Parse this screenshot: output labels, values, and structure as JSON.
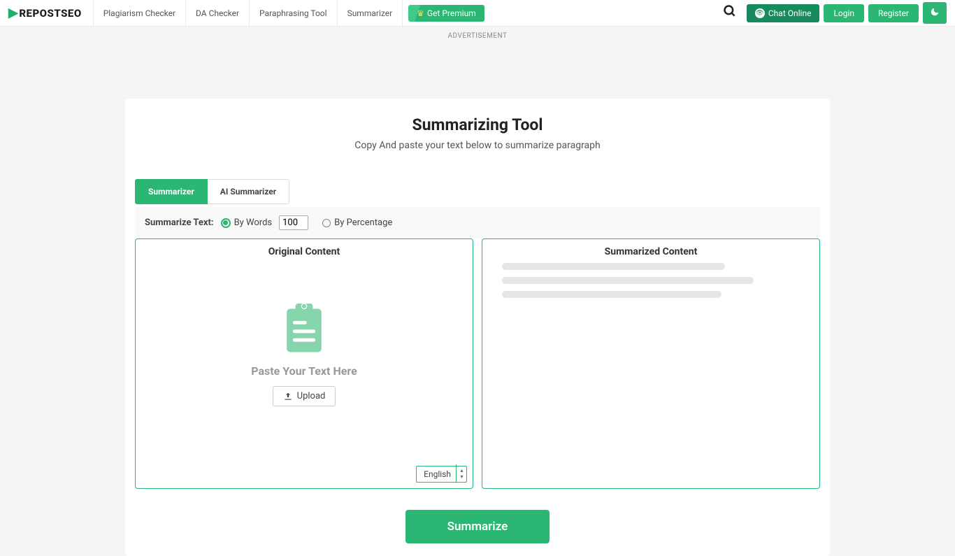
{
  "nav": {
    "logo": "REPOSTSEO",
    "links": [
      "Plagiarism Checker",
      "DA Checker",
      "Paraphrasing Tool",
      "Summarizer"
    ],
    "premium": "Get Premium",
    "chat": "Chat Online",
    "login": "Login",
    "register": "Register"
  },
  "ad_label": "ADVERTISEMENT",
  "page": {
    "title": "Summarizing Tool",
    "subtitle": "Copy And paste your text below to summarize paragraph"
  },
  "tabs": {
    "summarizer": "Summarizer",
    "ai": "AI Summarizer"
  },
  "options": {
    "label": "Summarize Text:",
    "by_words": "By Words",
    "words_value": "100",
    "by_percentage": "By Percentage"
  },
  "left_box": {
    "title": "Original Content",
    "placeholder": "Paste Your Text Here",
    "upload": "Upload",
    "language": "English"
  },
  "right_box": {
    "title": "Summarized Content"
  },
  "action": {
    "summarize": "Summarize"
  }
}
